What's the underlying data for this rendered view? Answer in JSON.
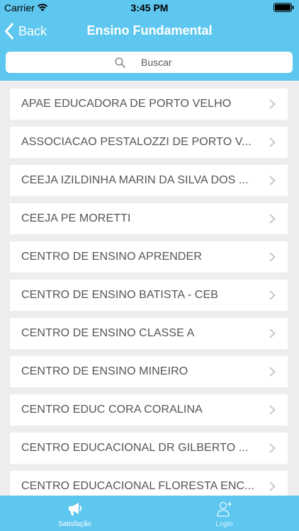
{
  "status_bar": {
    "carrier": "Carrier",
    "time": "3:45 PM"
  },
  "nav": {
    "back_label": "Back",
    "title": "Ensino Fundamental"
  },
  "search": {
    "placeholder": "Buscar"
  },
  "list": {
    "items": [
      {
        "label": "APAE EDUCADORA DE PORTO VELHO"
      },
      {
        "label": "ASSOCIACAO PESTALOZZI DE PORTO V..."
      },
      {
        "label": "CEEJA IZILDINHA MARIN DA SILVA DOS ..."
      },
      {
        "label": "CEEJA PE MORETTI"
      },
      {
        "label": "CENTRO DE ENSINO APRENDER"
      },
      {
        "label": "CENTRO DE ENSINO BATISTA - CEB"
      },
      {
        "label": "CENTRO DE ENSINO CLASSE A"
      },
      {
        "label": "CENTRO DE ENSINO MINEIRO"
      },
      {
        "label": "CENTRO EDUC CORA CORALINA"
      },
      {
        "label": "CENTRO EDUCACIONAL DR GILBERTO ..."
      },
      {
        "label": "CENTRO EDUCACIONAL FLORESTA ENC..."
      }
    ]
  },
  "tab_bar": {
    "tabs": [
      {
        "label": "Satisfação",
        "icon": "megaphone-icon",
        "active": true
      },
      {
        "label": "Login",
        "icon": "user-add-icon",
        "active": false
      }
    ]
  },
  "colors": {
    "accent": "#5ec7ef",
    "background": "#ededed",
    "item_text": "#555555",
    "chevron": "#c7c7cc"
  }
}
